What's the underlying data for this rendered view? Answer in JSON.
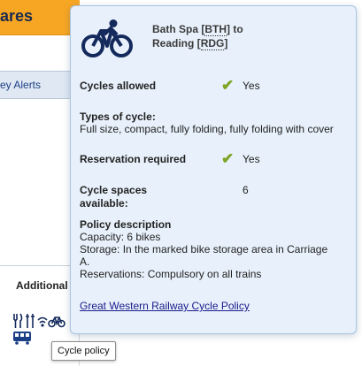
{
  "background": {
    "header_title": "ares",
    "alerts_label": "ey Alerts",
    "additional_label": "Additional",
    "amenity_icons": [
      "restaurant-icon",
      "cutlery-icon",
      "wifi-icon",
      "bicycle-icon",
      "train-icon"
    ]
  },
  "tooltip": {
    "text": "Cycle policy"
  },
  "popover": {
    "icon": "bicycle-icon",
    "route": {
      "from_name": "Bath Spa",
      "from_code": "BTH",
      "connector": "to",
      "to_name": "Reading",
      "to_code": "RDG"
    },
    "cycles_allowed": {
      "label": "Cycles allowed",
      "value": "Yes"
    },
    "types_of_cycle": {
      "label": "Types of cycle:",
      "value": "Full size, compact, fully folding, fully folding with cover"
    },
    "reservation_required": {
      "label": "Reservation required",
      "value": "Yes"
    },
    "cycle_spaces": {
      "label_line1": "Cycle spaces",
      "label_line2": "available:",
      "value": "6"
    },
    "policy_description": {
      "label": "Policy description",
      "capacity": "Capacity: 6 bikes",
      "storage": "Storage: In the marked bike storage area in Carriage A.",
      "reservations": "Reservations: Compulsory on all trains"
    },
    "link": "Great Western Railway Cycle Policy",
    "colors": {
      "accent_check": "#7da425",
      "popover_background": "#e8f1fb",
      "icon_navy": "#142a5c",
      "header_orange": "#f7a623"
    }
  }
}
